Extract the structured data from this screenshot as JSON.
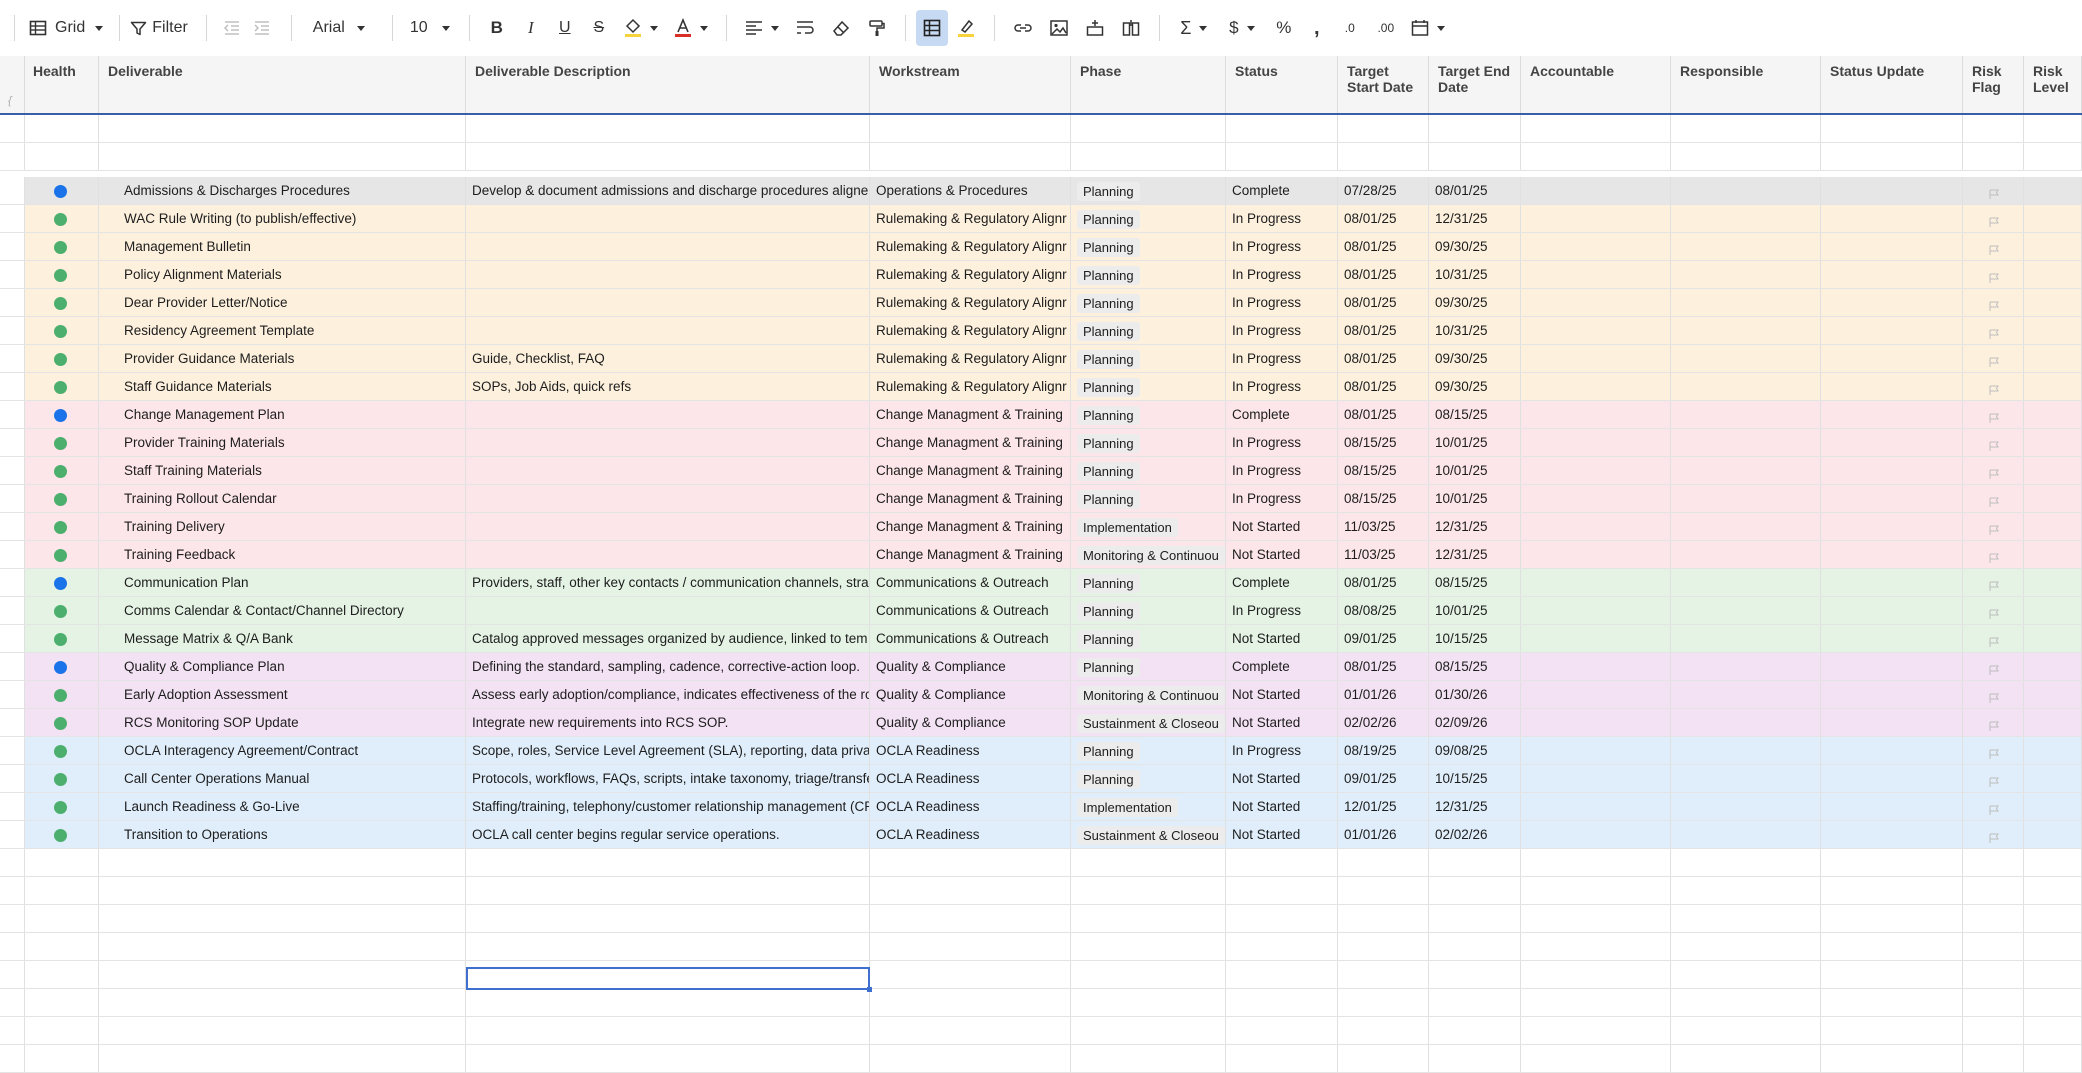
{
  "toolbar": {
    "view_label": "Grid",
    "filter_label": "Filter",
    "font_name": "Arial",
    "font_size": "10"
  },
  "columns": [
    {
      "key": "health",
      "label": "Health"
    },
    {
      "key": "deliverable",
      "label": "Deliverable"
    },
    {
      "key": "description",
      "label": "Deliverable Description"
    },
    {
      "key": "workstream",
      "label": "Workstream"
    },
    {
      "key": "phase",
      "label": "Phase"
    },
    {
      "key": "status",
      "label": "Status"
    },
    {
      "key": "start",
      "label": "Target Start Date"
    },
    {
      "key": "end",
      "label": "Target End Date"
    },
    {
      "key": "accountable",
      "label": "Accountable"
    },
    {
      "key": "responsible",
      "label": "Responsible"
    },
    {
      "key": "status_update",
      "label": "Status Update"
    },
    {
      "key": "risk_flag",
      "label": "Risk Flag"
    },
    {
      "key": "risk_level",
      "label": "Risk Level"
    }
  ],
  "colors": {
    "health_green": "#4caf6e",
    "health_blue": "#1a73e8",
    "group_ops": "#e6e6e6",
    "group_rule": "#fdf1de",
    "group_change": "#fde6ea",
    "group_comms": "#e5f3e4",
    "group_quality": "#f3e2f3",
    "group_ocla": "#e0eefb"
  },
  "rows": [
    {
      "health": "blue",
      "group": "ops",
      "deliverable": "Admissions & Discharges Procedures",
      "description": "Develop & document admissions and discharge procedures aligne",
      "workstream": "Operations & Procedures",
      "phase": "Planning",
      "status": "Complete",
      "start": "07/28/25",
      "end": "08/01/25"
    },
    {
      "health": "green",
      "group": "rule",
      "deliverable": "WAC Rule Writing (to publish/effective)",
      "description": "",
      "workstream": "Rulemaking & Regulatory Alignr",
      "phase": "Planning",
      "status": "In Progress",
      "start": "08/01/25",
      "end": "12/31/25"
    },
    {
      "health": "green",
      "group": "rule",
      "deliverable": "Management Bulletin",
      "description": "",
      "workstream": "Rulemaking & Regulatory Alignr",
      "phase": "Planning",
      "status": "In Progress",
      "start": "08/01/25",
      "end": "09/30/25"
    },
    {
      "health": "green",
      "group": "rule",
      "deliverable": "Policy Alignment Materials",
      "description": "",
      "workstream": "Rulemaking & Regulatory Alignr",
      "phase": "Planning",
      "status": "In Progress",
      "start": "08/01/25",
      "end": "10/31/25"
    },
    {
      "health": "green",
      "group": "rule",
      "deliverable": "Dear Provider Letter/Notice",
      "description": "",
      "workstream": "Rulemaking & Regulatory Alignr",
      "phase": "Planning",
      "status": "In Progress",
      "start": "08/01/25",
      "end": "09/30/25"
    },
    {
      "health": "green",
      "group": "rule",
      "deliverable": "Residency Agreement Template",
      "description": "",
      "workstream": "Rulemaking & Regulatory Alignr",
      "phase": "Planning",
      "status": "In Progress",
      "start": "08/01/25",
      "end": "10/31/25"
    },
    {
      "health": "green",
      "group": "rule",
      "deliverable": "Provider Guidance Materials",
      "description": "Guide, Checklist, FAQ",
      "workstream": "Rulemaking & Regulatory Alignr",
      "phase": "Planning",
      "status": "In Progress",
      "start": "08/01/25",
      "end": "09/30/25"
    },
    {
      "health": "green",
      "group": "rule",
      "deliverable": "Staff Guidance Materials",
      "description": "SOPs, Job Aids, quick refs",
      "workstream": "Rulemaking & Regulatory Alignr",
      "phase": "Planning",
      "status": "In Progress",
      "start": "08/01/25",
      "end": "09/30/25"
    },
    {
      "health": "blue",
      "group": "change",
      "deliverable": "Change Management Plan",
      "description": "",
      "workstream": "Change Managment & Training",
      "phase": "Planning",
      "status": "Complete",
      "start": "08/01/25",
      "end": "08/15/25"
    },
    {
      "health": "green",
      "group": "change",
      "deliverable": "Provider Training Materials",
      "description": "",
      "workstream": "Change Managment & Training",
      "phase": "Planning",
      "status": "In Progress",
      "start": "08/15/25",
      "end": "10/01/25"
    },
    {
      "health": "green",
      "group": "change",
      "deliverable": "Staff Training Materials",
      "description": "",
      "workstream": "Change Managment & Training",
      "phase": "Planning",
      "status": "In Progress",
      "start": "08/15/25",
      "end": "10/01/25"
    },
    {
      "health": "green",
      "group": "change",
      "deliverable": "Training Rollout Calendar",
      "description": "",
      "workstream": "Change Managment & Training",
      "phase": "Planning",
      "status": "In Progress",
      "start": "08/15/25",
      "end": "10/01/25"
    },
    {
      "health": "green",
      "group": "change",
      "deliverable": "Training Delivery",
      "description": "",
      "workstream": "Change Managment & Training",
      "phase": "Implementation",
      "status": "Not Started",
      "start": "11/03/25",
      "end": "12/31/25"
    },
    {
      "health": "green",
      "group": "change",
      "deliverable": "Training Feedback",
      "description": "",
      "workstream": "Change Managment & Training",
      "phase": "Monitoring & Continuou",
      "status": "Not Started",
      "start": "11/03/25",
      "end": "12/31/25"
    },
    {
      "health": "blue",
      "group": "comms",
      "deliverable": "Communication Plan",
      "description": "Providers, staff, other key contacts / communication channels, stra",
      "workstream": "Communications & Outreach",
      "phase": "Planning",
      "status": "Complete",
      "start": "08/01/25",
      "end": "08/15/25"
    },
    {
      "health": "green",
      "group": "comms",
      "deliverable": "Comms Calendar & Contact/Channel Directory",
      "description": "",
      "workstream": "Communications & Outreach",
      "phase": "Planning",
      "status": "In Progress",
      "start": "08/08/25",
      "end": "10/01/25"
    },
    {
      "health": "green",
      "group": "comms",
      "deliverable": "Message Matrix & Q/A Bank",
      "description": "Catalog approved messages organized by audience, linked to tem",
      "workstream": "Communications & Outreach",
      "phase": "Planning",
      "status": "Not Started",
      "start": "09/01/25",
      "end": "10/15/25"
    },
    {
      "health": "blue",
      "group": "quality",
      "deliverable": "Quality & Compliance Plan",
      "description": "Defining the standard, sampling, cadence, corrective-action loop.",
      "workstream": "Quality & Compliance",
      "phase": "Planning",
      "status": "Complete",
      "start": "08/01/25",
      "end": "08/15/25"
    },
    {
      "health": "green",
      "group": "quality",
      "deliverable": "Early Adoption Assessment",
      "description": "Assess early adoption/compliance, indicates effectiveness of the ro",
      "workstream": "Quality & Compliance",
      "phase": "Monitoring & Continuou",
      "status": "Not Started",
      "start": "01/01/26",
      "end": "01/30/26"
    },
    {
      "health": "green",
      "group": "quality",
      "deliverable": "RCS Monitoring SOP Update",
      "description": "Integrate new requirements into RCS SOP.",
      "workstream": "Quality & Compliance",
      "phase": "Sustainment & Closeou",
      "status": "Not Started",
      "start": "02/02/26",
      "end": "02/09/26"
    },
    {
      "health": "green",
      "group": "ocla",
      "deliverable": "OCLA Interagency Agreement/Contract",
      "description": "Scope, roles, Service Level Agreement (SLA), reporting, data priva",
      "workstream": "OCLA Readiness",
      "phase": "Planning",
      "status": "In Progress",
      "start": "08/19/25",
      "end": "09/08/25"
    },
    {
      "health": "green",
      "group": "ocla",
      "deliverable": "Call Center Operations Manual",
      "description": "Protocols, workflows, FAQs, scripts, intake taxonomy, triage/transfe",
      "workstream": "OCLA Readiness",
      "phase": "Planning",
      "status": "Not Started",
      "start": "09/01/25",
      "end": "10/15/25"
    },
    {
      "health": "green",
      "group": "ocla",
      "deliverable": "Launch Readiness & Go-Live",
      "description": "Staffing/training, telephony/customer relationship management (CR",
      "workstream": "OCLA Readiness",
      "phase": "Implementation",
      "status": "Not Started",
      "start": "12/01/25",
      "end": "12/31/25"
    },
    {
      "health": "green",
      "group": "ocla",
      "deliverable": "Transition to Operations",
      "description": "OCLA call center begins regular service operations.",
      "workstream": "OCLA Readiness",
      "phase": "Sustainment & Closeou",
      "status": "Not Started",
      "start": "01/01/26",
      "end": "02/02/26"
    }
  ]
}
